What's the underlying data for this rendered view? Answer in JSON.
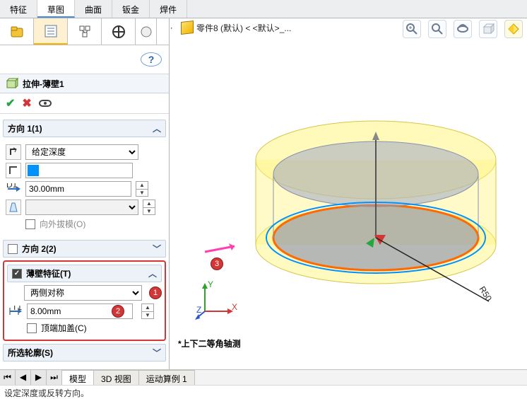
{
  "ribbon": {
    "tabs": [
      "特征",
      "草图",
      "曲面",
      "钣金",
      "焊件"
    ],
    "active": 1
  },
  "feature": {
    "title": "拉伸-薄壁1"
  },
  "direction1": {
    "header": "方向 1(1)",
    "end_condition": "给定深度",
    "depth": "30.00mm",
    "draft_outward_label": "向外拔模(O)"
  },
  "direction2": {
    "header": "方向 2(2)"
  },
  "thin": {
    "header": "薄壁特征(T)",
    "type": "两侧对称",
    "thickness": "8.00mm",
    "cap_label": "顶端加盖(C)"
  },
  "contours": {
    "header": "所选轮廓(S)"
  },
  "breadcrumb": {
    "label": "零件8 (默认) < <默认>_..."
  },
  "viewport_note": "*上下二等角轴测",
  "radius_label": "R50",
  "bottom_tabs": [
    "模型",
    "3D 视图",
    "运动算例 1"
  ],
  "bottom_active": 0,
  "status": "设定深度或反转方向。",
  "callouts": {
    "one": "1",
    "two": "2",
    "three": "3"
  }
}
